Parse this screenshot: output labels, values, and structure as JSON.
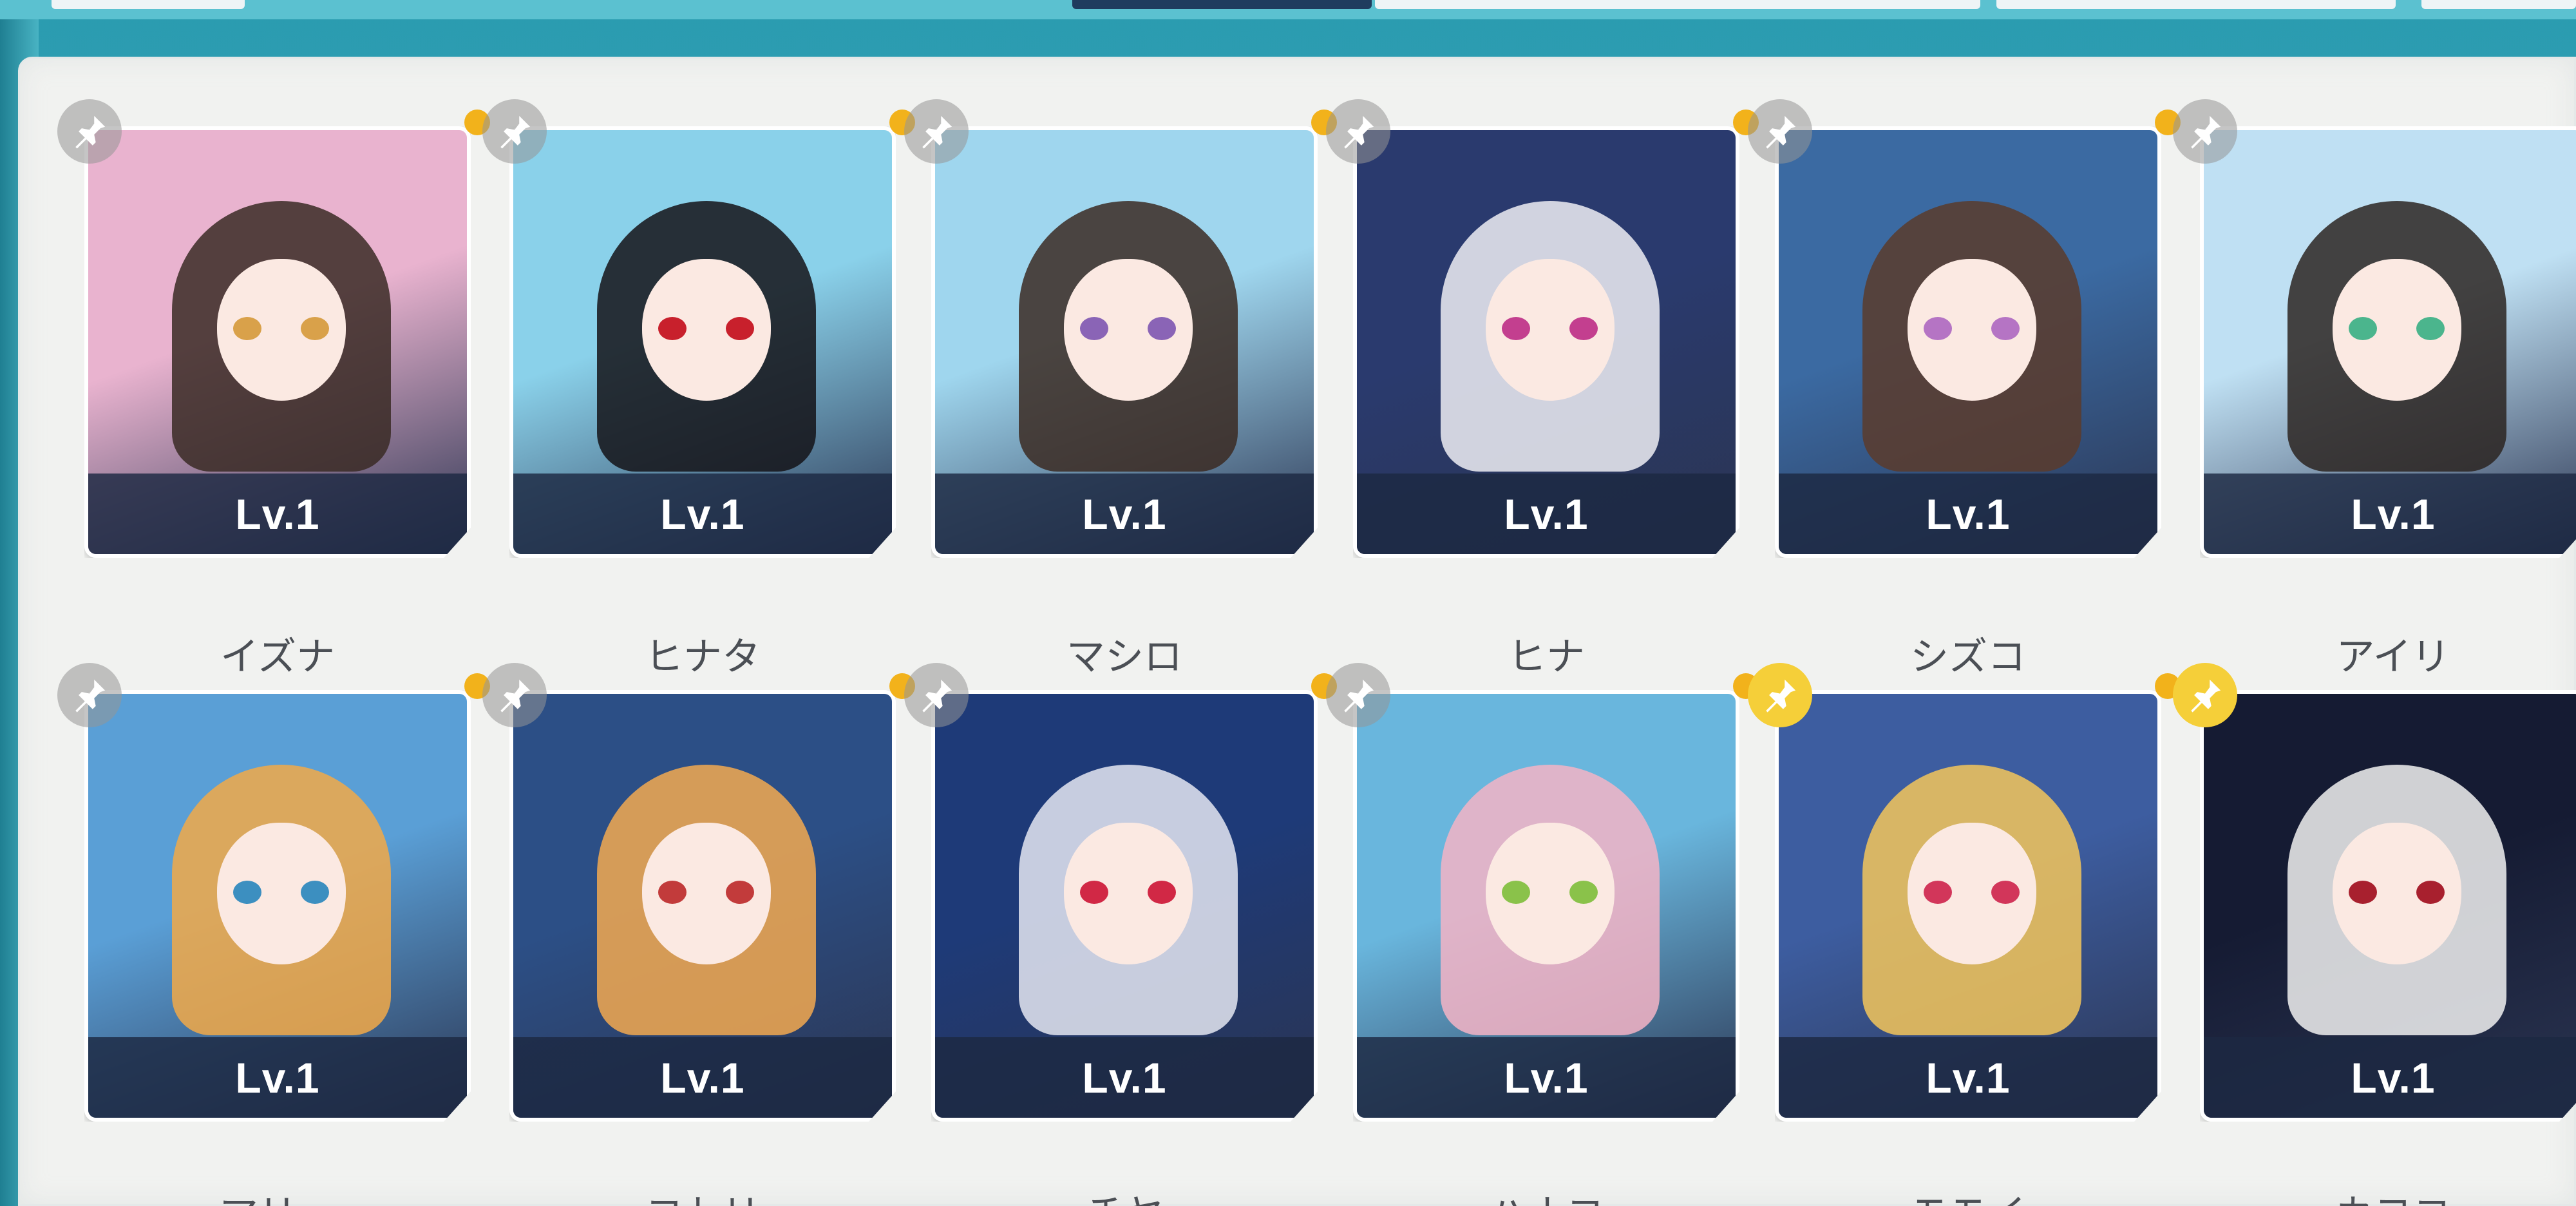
{
  "colors": {
    "pin_inactive": "#969696",
    "pin_active": "#f5cf39",
    "notification_dot": "#f2b21b",
    "level_bar": "#1c2842",
    "name_text": "#4b4f55",
    "panel_bg": "#f1f2f0"
  },
  "icons": {
    "pin": "pushpin-icon",
    "dot": "notification-dot-icon"
  },
  "students": [
    {
      "level": "Lv.1",
      "name": "イズナ",
      "pinned": false,
      "palette": [
        "#e9b3cf",
        "#3a2a24",
        "#d9a14a"
      ]
    },
    {
      "level": "Lv.1",
      "name": "ヒナタ",
      "pinned": false,
      "palette": [
        "#8ad1ea",
        "#141318",
        "#c8202c"
      ]
    },
    {
      "level": "Lv.1",
      "name": "マシロ",
      "pinned": false,
      "palette": [
        "#9fd6ee",
        "#3b2a22",
        "#8a64b6"
      ]
    },
    {
      "level": "Lv.1",
      "name": "ヒナ",
      "pinned": false,
      "palette": [
        "#2a3a6e",
        "#eeeef4",
        "#c33f8f"
      ]
    },
    {
      "level": "Lv.1",
      "name": "シズコ",
      "pinned": false,
      "palette": [
        "#3b6aa2",
        "#5a3b2b",
        "#b574c4"
      ]
    },
    {
      "level": "Lv.1",
      "name": "アイリ",
      "pinned": false,
      "palette": [
        "#bfe0f3",
        "#2c2521",
        "#4bb58d"
      ]
    },
    {
      "level": "Lv.1",
      "name": "マリー",
      "pinned": false,
      "palette": [
        "#5a9fd6",
        "#f2a948",
        "#3c8fc0"
      ]
    },
    {
      "level": "Lv.1",
      "name": "コトリ",
      "pinned": false,
      "palette": [
        "#2c4f86",
        "#f3a950",
        "#c23b3b"
      ]
    },
    {
      "level": "Lv.1",
      "name": "チヤ",
      "pinned": false,
      "palette": [
        "#1e3a78",
        "#e5e8f2",
        "#d12845"
      ]
    },
    {
      "level": "Lv.1",
      "name": "ハナコ",
      "pinned": false,
      "palette": [
        "#69b6dd",
        "#f5b4c6",
        "#8ac24a"
      ]
    },
    {
      "level": "Lv.1",
      "name": "モモイ",
      "pinned": true,
      "palette": [
        "#3d5da0",
        "#f3c55a",
        "#d2365a"
      ]
    },
    {
      "level": "Lv.1",
      "name": "カヨコ",
      "pinned": true,
      "palette": [
        "#151b33",
        "#f1f1f1",
        "#a8202e"
      ]
    }
  ]
}
